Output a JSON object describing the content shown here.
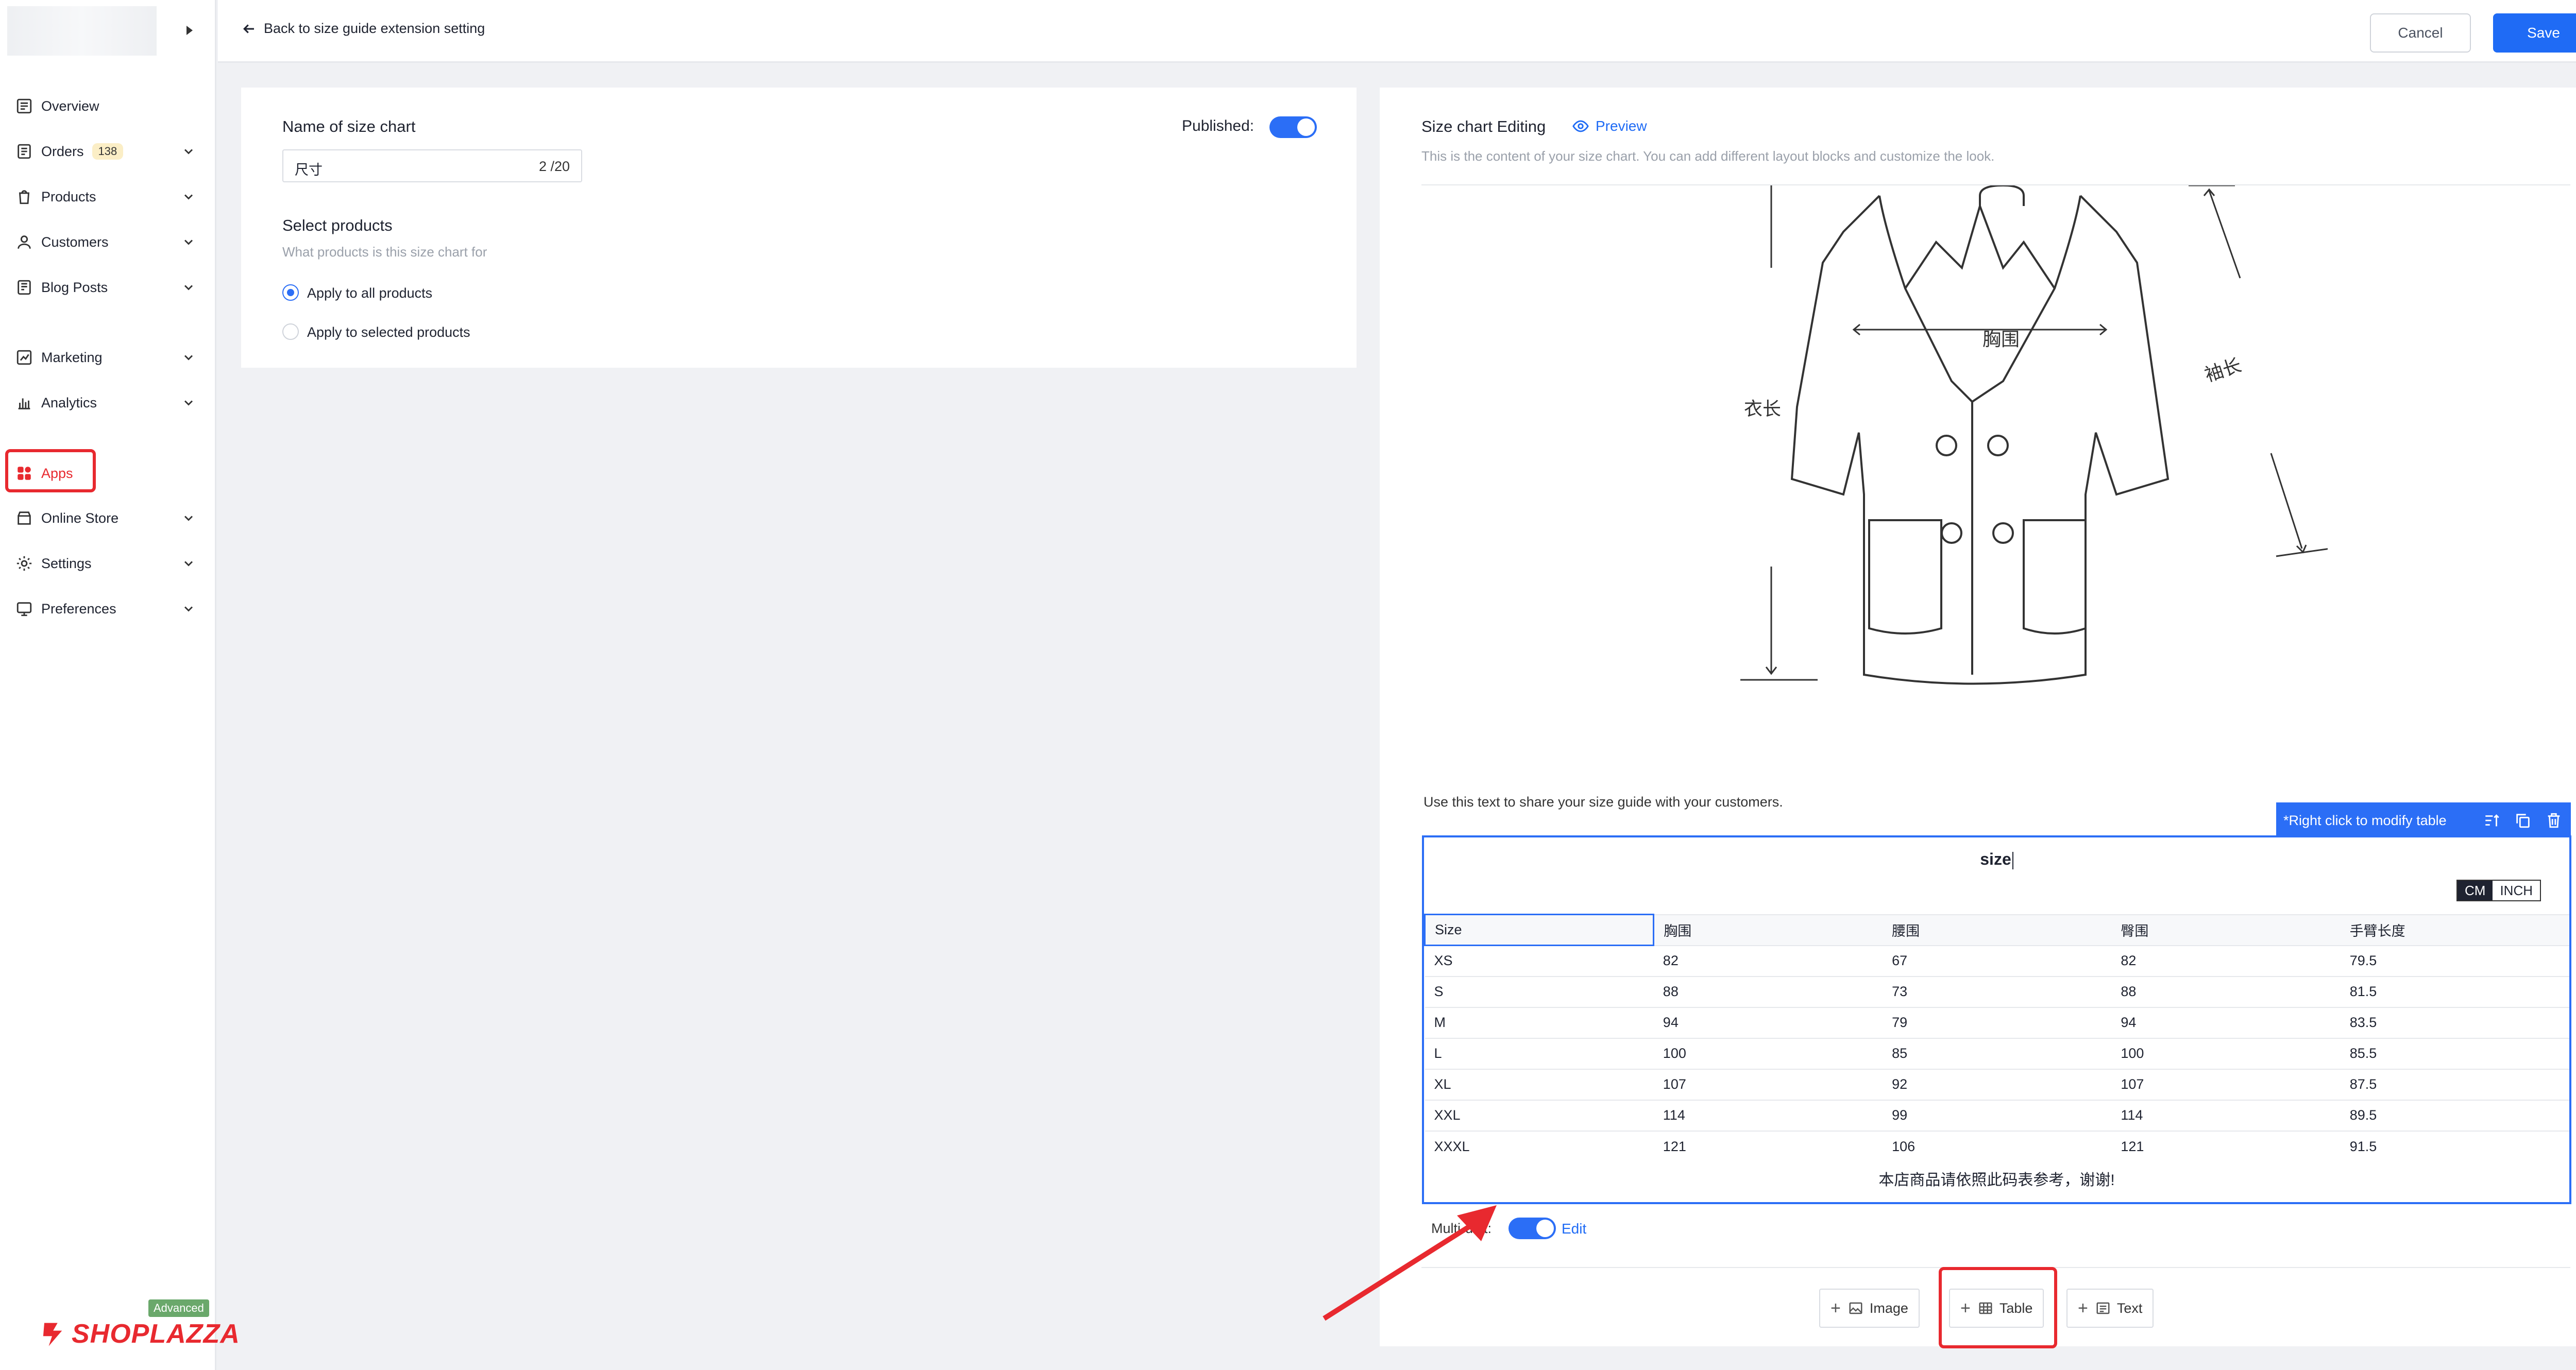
{
  "sidebar": {
    "items": [
      {
        "label": "Overview",
        "icon": "overview-icon",
        "chevron": false
      },
      {
        "label": "Orders",
        "icon": "orders-icon",
        "badge": "138",
        "chevron": true
      },
      {
        "label": "Products",
        "icon": "products-icon",
        "chevron": true
      },
      {
        "label": "Customers",
        "icon": "customers-icon",
        "chevron": true
      },
      {
        "label": "Blog Posts",
        "icon": "blog-icon",
        "chevron": true
      },
      {
        "label": "Marketing",
        "icon": "marketing-icon",
        "chevron": true
      },
      {
        "label": "Analytics",
        "icon": "analytics-icon",
        "chevron": true
      },
      {
        "label": "Apps",
        "icon": "apps-icon",
        "chevron": false,
        "active": true
      },
      {
        "label": "Online Store",
        "icon": "online-store-icon",
        "chevron": true
      },
      {
        "label": "Settings",
        "icon": "settings-icon",
        "chevron": true
      },
      {
        "label": "Preferences",
        "icon": "preferences-icon",
        "chevron": true
      }
    ],
    "brand": "SHOPLAZZA",
    "plan_badge": "Advanced"
  },
  "topbar": {
    "back_label": "Back to size guide extension setting",
    "cancel_label": "Cancel",
    "save_label": "Save"
  },
  "form": {
    "name_label": "Name of size chart",
    "name_value": "尺寸",
    "name_counter": "2 /20",
    "published_label": "Published:",
    "published": true,
    "select_products_label": "Select products",
    "select_products_desc": "What products is this size chart for",
    "options": [
      {
        "label": "Apply to all products",
        "selected": true
      },
      {
        "label": "Apply to selected products",
        "selected": false
      }
    ]
  },
  "editor": {
    "title": "Size chart Editing",
    "preview_label": "Preview",
    "description": "This is the content of your size chart. You can add different layout blocks and customize the look.",
    "image_labels": {
      "chest": "胸围",
      "length": "衣长",
      "sleeve": "袖长"
    },
    "share_text": "Use this text to share your size guide with your customers.",
    "table_toolbar_label": "*Right click to modify table",
    "table_title": "size",
    "units": [
      "CM",
      "INCH"
    ],
    "active_unit": "CM",
    "table": {
      "headers": [
        "Size",
        "胸围",
        "腰围",
        "臀围",
        "手臂长度"
      ],
      "rows": [
        [
          "XS",
          "82",
          "67",
          "82",
          "79.5"
        ],
        [
          "S",
          "88",
          "73",
          "88",
          "81.5"
        ],
        [
          "M",
          "94",
          "79",
          "94",
          "83.5"
        ],
        [
          "L",
          "100",
          "85",
          "100",
          "85.5"
        ],
        [
          "XL",
          "107",
          "92",
          "107",
          "87.5"
        ],
        [
          "XXL",
          "114",
          "99",
          "114",
          "89.5"
        ],
        [
          "XXXL",
          "121",
          "106",
          "121",
          "91.5"
        ]
      ]
    },
    "table_footer": "本店商品请依照此码表参考，谢谢!",
    "multi_unit_label": "Multi-unit:",
    "multi_unit": true,
    "edit_label": "Edit",
    "add_buttons": [
      "Image",
      "Table",
      "Text"
    ]
  },
  "colors": {
    "accent": "#2b6ef6",
    "highlight": "#e8292f",
    "brand": "#e8292f"
  }
}
